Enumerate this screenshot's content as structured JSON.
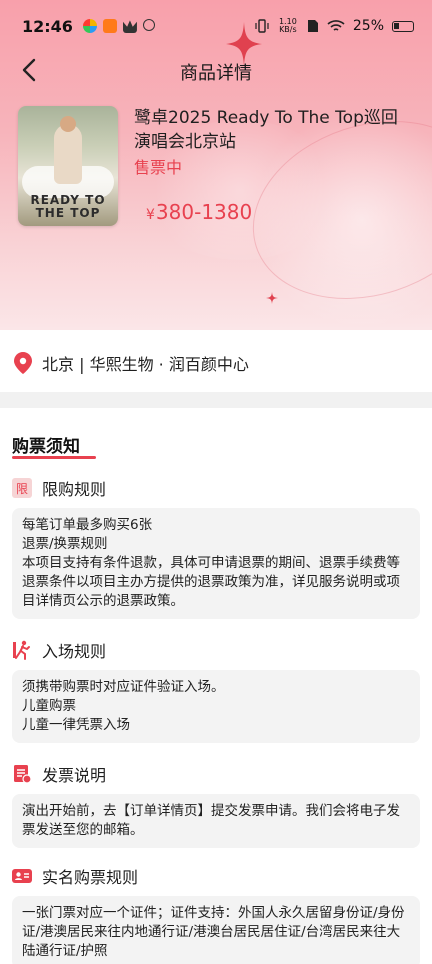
{
  "status_bar": {
    "time": "12:46",
    "net_speed": "1.10 KB/s",
    "battery": "25%"
  },
  "nav": {
    "title": "商品详情"
  },
  "event": {
    "poster_text": "READY TO THE TOP",
    "title": "鹭卓2025 Ready To The Top巡回演唱会北京站",
    "status": "售票中",
    "price_symbol": "¥",
    "price_range": "380-1380"
  },
  "venue": {
    "text": "北京 | 华熙生物 · 润百颜中心"
  },
  "notice": {
    "title": "购票须知",
    "sections": [
      {
        "icon": "limit-badge",
        "badge_text": "限",
        "heading": "限购规则",
        "lines": [
          "每笔订单最多购买6张",
          "退票/换票规则",
          "本项目支持有条件退款，具体可申请退票的期间、退票手续费等退票条件以项目主办方提供的退票政策为准，详见服务说明或项目详情页公示的退票政策。"
        ]
      },
      {
        "icon": "entry-icon",
        "heading": "入场规则",
        "lines": [
          "须携带购票时对应证件验证入场。",
          "儿童购票",
          "儿童一律凭票入场"
        ]
      },
      {
        "icon": "invoice-icon",
        "heading": "发票说明",
        "lines": [
          "演出开始前，去【订单详情页】提交发票申请。我们会将电子发票发送至您的邮箱。"
        ]
      },
      {
        "icon": "id-card-icon",
        "heading": "实名购票规则",
        "lines": [
          "一张门票对应一个证件；证件支持：外国人永久居留身份证/身份证/港澳居民来往内地通行证/港澳台居民居住证/台湾居民来往大陆通行证/护照"
        ]
      }
    ]
  },
  "colors": {
    "accent": "#e8414f",
    "hero_top": "#f8a0ab",
    "box_bg": "#f3f3f3"
  }
}
